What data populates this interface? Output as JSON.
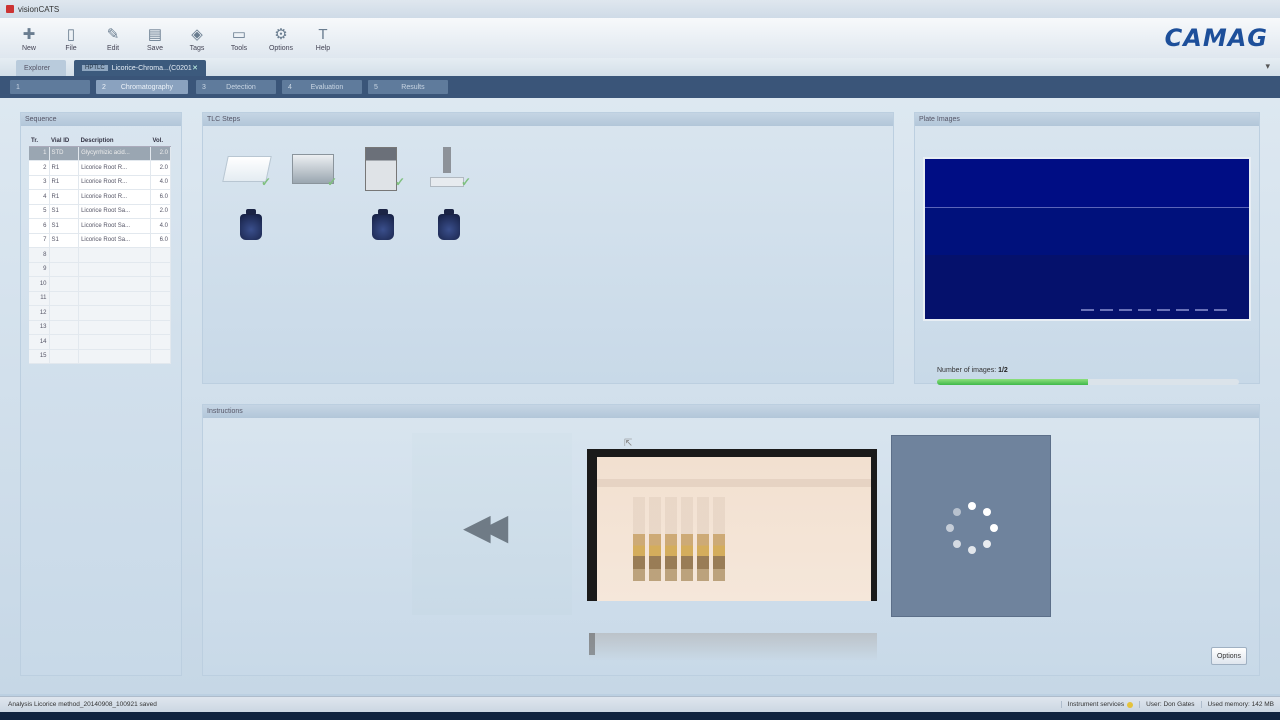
{
  "window": {
    "title": "visionCATS"
  },
  "toolbar": {
    "items": [
      {
        "label": "New",
        "icon": "plus-icon",
        "glyph": "✚"
      },
      {
        "label": "File",
        "icon": "file-icon",
        "glyph": "▯"
      },
      {
        "label": "Edit",
        "icon": "pencil-icon",
        "glyph": "✎"
      },
      {
        "label": "Save",
        "icon": "disk-icon",
        "glyph": "▤"
      },
      {
        "label": "Tags",
        "icon": "tag-icon",
        "glyph": "◈"
      },
      {
        "label": "Tools",
        "icon": "toolbox-icon",
        "glyph": "▭"
      },
      {
        "label": "Options",
        "icon": "gear-icon",
        "glyph": "⚙"
      },
      {
        "label": "Help",
        "icon": "help-icon",
        "glyph": "T"
      }
    ],
    "logo": "CAMAG"
  },
  "tabs": {
    "inactive_label": "Explorer",
    "active_tag": "HPTLC",
    "active_label": "Licorice-Chroma...(C0201",
    "close_glyph": "✕",
    "pin_glyph": "▾"
  },
  "steps": [
    {
      "num": "1",
      "label": ""
    },
    {
      "num": "2",
      "label": "Chromatography"
    },
    {
      "num": "3",
      "label": "Detection"
    },
    {
      "num": "4",
      "label": "Evaluation"
    },
    {
      "num": "5",
      "label": "Results"
    }
  ],
  "sequence": {
    "header": "Sequence",
    "columns": [
      "Tr.",
      "Vial ID",
      "Description",
      "Vol."
    ],
    "rows": [
      [
        "1",
        "STD",
        "Glycyrrhizic acid...",
        "2.0"
      ],
      [
        "2",
        "R1",
        "Licorice Root R...",
        "2.0"
      ],
      [
        "3",
        "R1",
        "Licorice Root R...",
        "4.0"
      ],
      [
        "4",
        "R1",
        "Licorice Root R...",
        "6.0"
      ],
      [
        "5",
        "S1",
        "Licorice Root Sa...",
        "2.0"
      ],
      [
        "6",
        "S1",
        "Licorice Root Sa...",
        "4.0"
      ],
      [
        "7",
        "S1",
        "Licorice Root Sa...",
        "6.0"
      ],
      [
        "8",
        "",
        "",
        ""
      ],
      [
        "9",
        "",
        "",
        ""
      ],
      [
        "10",
        "",
        "",
        ""
      ],
      [
        "11",
        "",
        "",
        ""
      ],
      [
        "12",
        "",
        "",
        ""
      ],
      [
        "13",
        "",
        "",
        ""
      ],
      [
        "14",
        "",
        "",
        ""
      ],
      [
        "15",
        "",
        "",
        ""
      ]
    ]
  },
  "tlc_steps": {
    "header": "TLC Steps"
  },
  "plate_images": {
    "header": "Plate Images",
    "count_label": "Number of images:",
    "count_value": "1/2",
    "progress": 0.5
  },
  "instructions": {
    "header": "Instructions",
    "back_glyph": "◀◀",
    "options_label": "Options"
  },
  "status": {
    "message": "Analysis Licorice method_20140908_100921 saved",
    "instrument": "Instrument services",
    "user": "User: Don Gates",
    "memory": "Used memory: 142 MB"
  },
  "colors": {
    "accent_blue": "#3a5579",
    "logo_blue": "#1d4f9a",
    "progress_green": "#3fb84a",
    "status_yellow": "#e4c23c"
  }
}
